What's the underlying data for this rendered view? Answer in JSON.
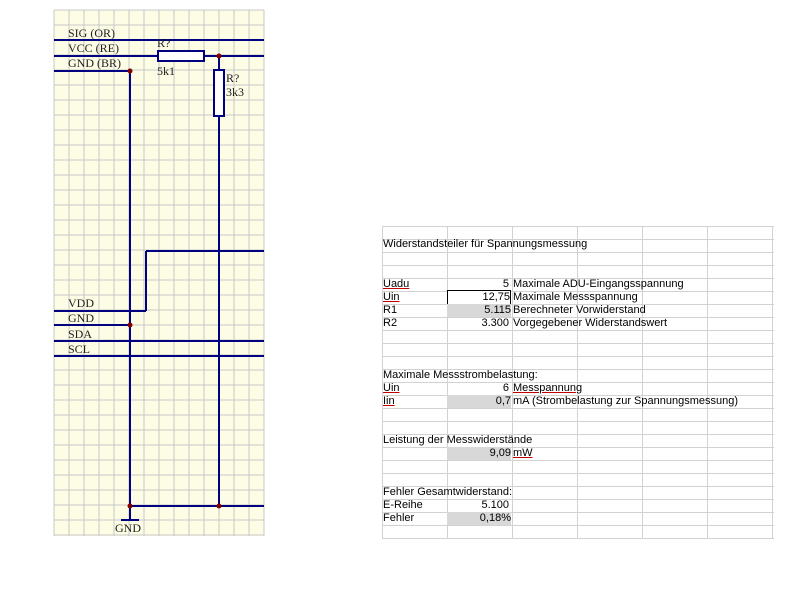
{
  "schematic": {
    "bus_labels": {
      "sig": "SIG (OR)",
      "vcc": "VCC (RE)",
      "gnd_br": "GND (BR)",
      "vdd": "VDD",
      "gnd": "GND",
      "sda": "SDA",
      "scl": "SCL"
    },
    "r1": {
      "ref": "R?",
      "value": "5k1"
    },
    "r2": {
      "ref": "R?",
      "value": "3k3"
    },
    "ground_label": "GND",
    "colors": {
      "grid_bg": "#fdfde6",
      "grid_line": "#c8c8c8",
      "wire": "#000080",
      "junction": "#800000",
      "resistor": "#000080"
    }
  },
  "sheet": {
    "title": "Widerstandsteiler für Spannungsmessung",
    "rows": [
      {
        "label": "Uadu",
        "value": "5",
        "desc": "Maximale ADU-Eingangsspannung"
      },
      {
        "label": "Uin",
        "value": "12,75",
        "desc": "Maximale Messspannung"
      },
      {
        "label": "R1",
        "value": "5.115",
        "desc": "Berechneter Vorwiderstand"
      },
      {
        "label": "R2",
        "value": "3.300",
        "desc": "Vorgegebener Widerstandswert"
      }
    ],
    "section2": {
      "title": "Maximale Messstrombelastung:",
      "rows": [
        {
          "label": "Uin",
          "value": "6",
          "desc": "Messpannung"
        },
        {
          "label": "Iin",
          "value": "0,7",
          "desc": "mA (Strombelastung zur Spannungsmessung)"
        }
      ]
    },
    "section3": {
      "title": "Leistung der Messwiderstände",
      "value": "9,09",
      "unit": "mW"
    },
    "section4": {
      "title": "Fehler Gesamtwiderstand:",
      "rows": [
        {
          "label": "E-Reihe",
          "value": "5.100"
        },
        {
          "label": "Fehler",
          "value": "0,18%"
        }
      ]
    }
  }
}
